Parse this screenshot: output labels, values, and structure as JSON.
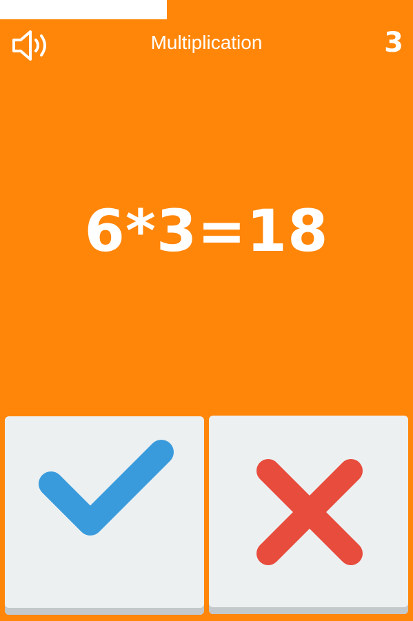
{
  "header": {
    "sound_icon": "speaker-volume-icon",
    "title": "Multiplication",
    "score": "3"
  },
  "question": {
    "equation": "6*3=18"
  },
  "answers": {
    "correct_icon": "check-mark-icon",
    "wrong_icon": "cross-x-icon"
  },
  "colors": {
    "background": "#ff8609",
    "button_face": "#ecf0f1",
    "button_shadow": "#c3c8cb",
    "check": "#3a9bdc",
    "cross": "#e74c3c",
    "text": "#ffffff"
  }
}
